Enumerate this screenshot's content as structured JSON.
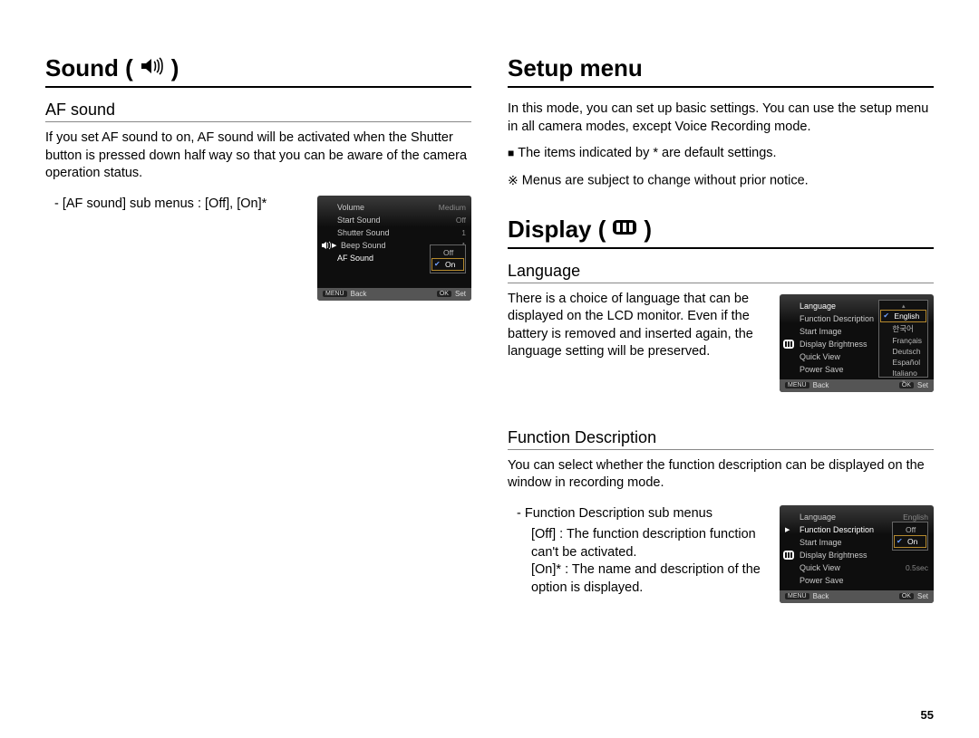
{
  "page_number": "55",
  "left": {
    "title": "Sound (",
    "title_close": " )",
    "section1": {
      "heading": "AF sound",
      "p1": "If you set AF sound to on, AF sound will be activated when the Shutter button is pressed down half way so that you can be aware of the camera operation status.",
      "sub": "- [AF sound] sub menus : [Off], [On]*"
    },
    "shot1": {
      "rows": [
        {
          "label": "Volume",
          "val": "Medium"
        },
        {
          "label": "Start Sound",
          "val": "Off"
        },
        {
          "label": "Shutter Sound",
          "val": "1"
        },
        {
          "label": "Beep Sound",
          "val": "1"
        },
        {
          "label": "AF Sound",
          "val": ""
        }
      ],
      "opts": [
        "Off",
        "On"
      ],
      "footer_back": "Back",
      "footer_set": "Set",
      "menu_tag": "MENU",
      "ok_tag": "OK"
    }
  },
  "right": {
    "title": "Setup menu",
    "intro": "In this mode, you can set up basic settings. You can use the setup menu in all camera modes, except Voice Recording mode.",
    "note1": "The items indicated by * are default settings.",
    "note2": "Menus are subject to change without prior notice.",
    "display_title": "Display (",
    "display_title_close": " )",
    "lang": {
      "heading": "Language",
      "p": "There is a choice of language that can be displayed on the LCD monitor. Even if the battery is removed and inserted again, the language setting will be preserved."
    },
    "shot2": {
      "rows": [
        {
          "label": "Language",
          "val": ""
        },
        {
          "label": "Function Description",
          "val": ""
        },
        {
          "label": "Start Image",
          "val": ""
        },
        {
          "label": "Display Brightness",
          "val": ""
        },
        {
          "label": "Quick View",
          "val": ""
        },
        {
          "label": "Power Save",
          "val": ""
        }
      ],
      "opts": [
        "English",
        "한국어",
        "Français",
        "Deutsch",
        "Español",
        "Italiano"
      ],
      "footer_back": "Back",
      "footer_set": "Set",
      "menu_tag": "MENU",
      "ok_tag": "OK"
    },
    "func": {
      "heading": "Function Description",
      "p": "You can select whether the function description can be displayed on the window in recording mode.",
      "sub": "- Function Description sub menus",
      "off_line": "[Off]  : The function description function can't be activated.",
      "on_line": "[On]* : The name and description of the option is displayed."
    },
    "shot3": {
      "rows": [
        {
          "label": "Language",
          "val": "English"
        },
        {
          "label": "Function Description",
          "val": ""
        },
        {
          "label": "Start Image",
          "val": ""
        },
        {
          "label": "Display Brightness",
          "val": ""
        },
        {
          "label": "Quick View",
          "val": "0.5sec"
        },
        {
          "label": "Power Save",
          "val": ""
        }
      ],
      "opts": [
        "Off",
        "On"
      ],
      "footer_back": "Back",
      "footer_set": "Set",
      "menu_tag": "MENU",
      "ok_tag": "OK"
    }
  }
}
